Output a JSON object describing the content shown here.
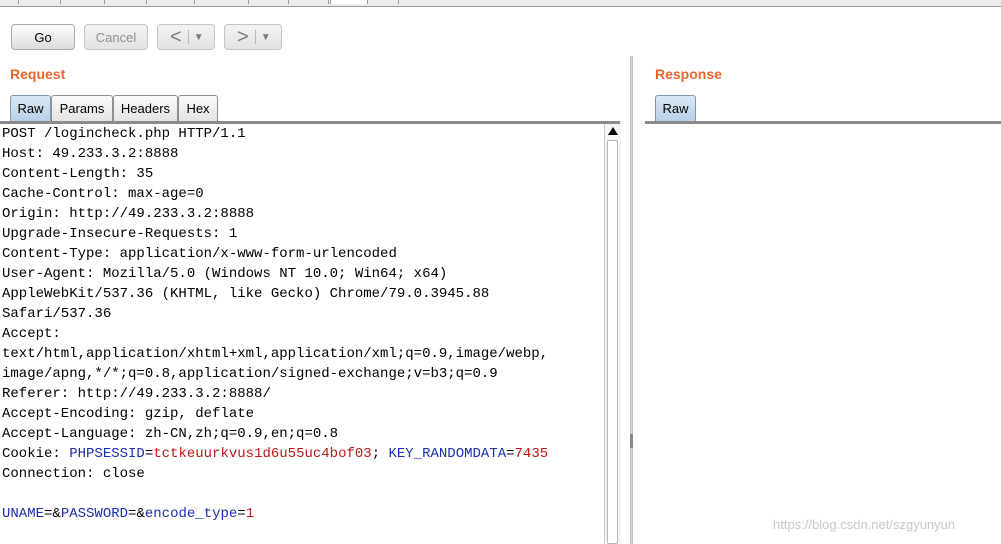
{
  "toolbar": {
    "go_label": "Go",
    "cancel_label": "Cancel",
    "back_glyph": "<",
    "forward_glyph": ">",
    "dropdown_glyph": "▼"
  },
  "request": {
    "title": "Request",
    "tabs": [
      {
        "label": "Raw",
        "active": true
      },
      {
        "label": "Params",
        "active": false
      },
      {
        "label": "Headers",
        "active": false
      },
      {
        "label": "Hex",
        "active": false
      }
    ],
    "lines": [
      "POST /logincheck.php HTTP/1.1",
      "Host: 49.233.3.2:8888",
      "Content-Length: 35",
      "Cache-Control: max-age=0",
      "Origin: http://49.233.3.2:8888",
      "Upgrade-Insecure-Requests: 1",
      "Content-Type: application/x-www-form-urlencoded",
      "User-Agent: Mozilla/5.0 (Windows NT 10.0; Win64; x64)",
      "AppleWebKit/537.36 (KHTML, like Gecko) Chrome/79.0.3945.88",
      "Safari/537.36",
      "Accept:",
      "text/html,application/xhtml+xml,application/xml;q=0.9,image/webp,",
      "image/apng,*/*;q=0.8,application/signed-exchange;v=b3;q=0.9",
      "Referer: http://49.233.3.2:8888/",
      "Accept-Encoding: gzip, deflate",
      "Accept-Language: zh-CN,zh;q=0.9,en;q=0.8"
    ],
    "cookie": {
      "prefix": "Cookie: ",
      "name1": "PHPSESSID",
      "eq1": "=",
      "value1": "tctkeuurkvus1d6u55uc4bof03",
      "sep": "; ",
      "name2": "KEY_RANDOMDATA",
      "eq2": "=",
      "value2": "7435"
    },
    "connection_line": "Connection: close",
    "body": {
      "p1": "UNAME",
      "t1": "=&",
      "p2": "PASSWORD",
      "t2": "=&",
      "p3": "encode_type",
      "t3": "=",
      "v3": "1"
    }
  },
  "response": {
    "title": "Response",
    "tabs": [
      {
        "label": "Raw",
        "active": true
      }
    ]
  },
  "watermark": "https://blog.csdn.net/szgyunyun",
  "colors": {
    "title_orange": "#e8662a",
    "param_blue": "#1c2eb0",
    "value_red": "#c01616"
  }
}
